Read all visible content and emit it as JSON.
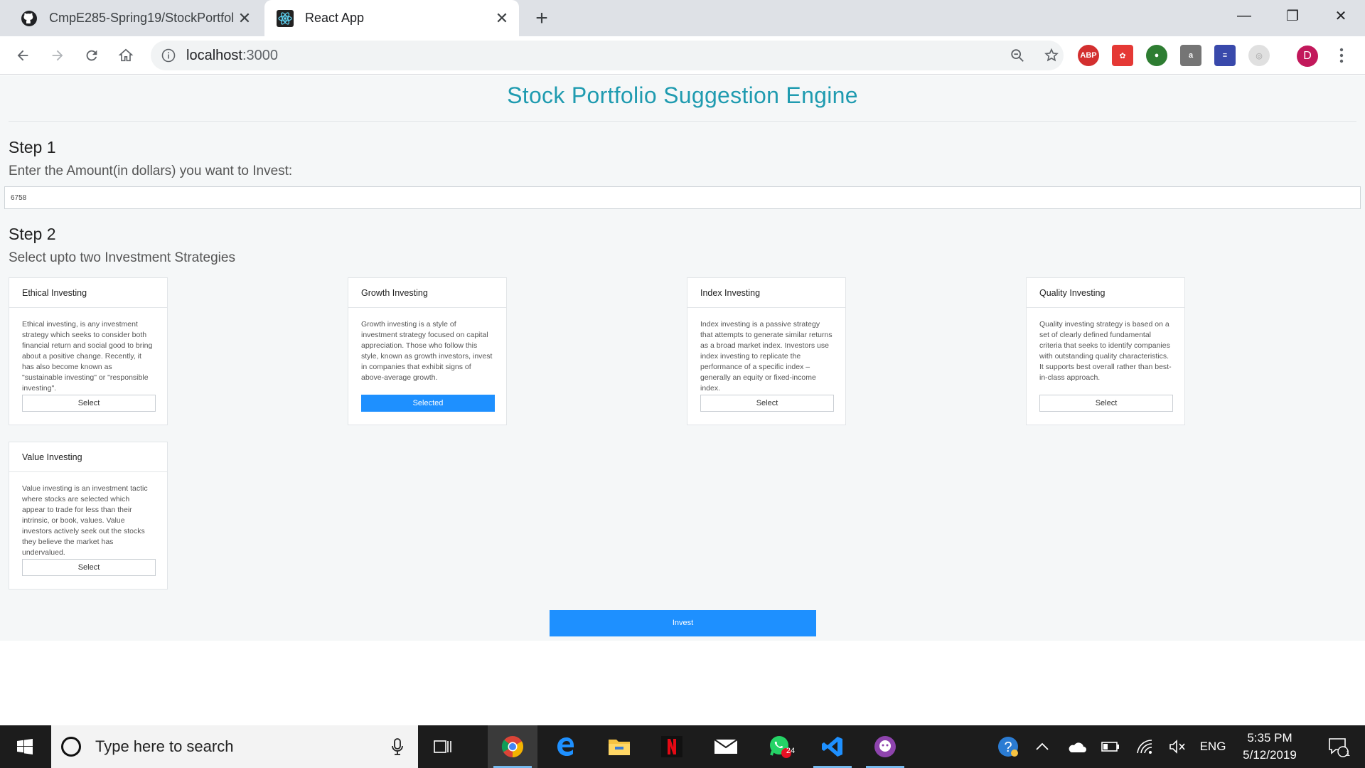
{
  "browser": {
    "tabs": [
      {
        "title": "CmpE285-Spring19/StockPortfoli",
        "icon": "github-icon",
        "active": false
      },
      {
        "title": "React App",
        "icon": "react-icon",
        "active": true
      }
    ],
    "url_host": "localhost",
    "url_port": ":3000",
    "profile_initial": "D",
    "extensions": [
      "adblock-icon",
      "ext-red-icon",
      "ext-green-icon",
      "ext-bag-icon",
      "ext-stack-icon",
      "ext-circle-icon"
    ]
  },
  "app": {
    "title": "Stock Portfolio Suggestion Engine",
    "step1": {
      "heading": "Step 1",
      "label": "Enter the Amount(in dollars) you want to Invest:",
      "amount_value": "6758"
    },
    "step2": {
      "heading": "Step 2",
      "label": "Select upto two Investment Strategies"
    },
    "strategies": [
      {
        "name": "Ethical Investing",
        "description": "Ethical investing, is any investment strategy which seeks to consider both financial return and social good to bring about a positive change. Recently, it has also become known as \"sustainable investing\" or \"responsible investing\".",
        "button": "Select",
        "selected": false
      },
      {
        "name": "Growth Investing",
        "description": "Growth investing is a style of investment strategy focused on capital appreciation. Those who follow this style, known as growth investors, invest in companies that exhibit signs of above-average growth.",
        "button": "Selected",
        "selected": true
      },
      {
        "name": "Index Investing",
        "description": "Index investing is a passive strategy that attempts to generate similar returns as a broad market index. Investors use index investing to replicate the performance of a specific index – generally an equity or fixed-income index.",
        "button": "Select",
        "selected": false
      },
      {
        "name": "Quality Investing",
        "description": "Quality investing strategy is based on a set of clearly defined fundamental criteria that seeks to identify companies with outstanding quality characteristics. It supports best overall rather than best-in-class approach.",
        "button": "Select",
        "selected": false
      },
      {
        "name": "Value Investing",
        "description": "Value investing is an investment tactic where stocks are selected which appear to trade for less than their intrinsic, or book, values. Value investors actively seek out the stocks they believe the market has undervalued.",
        "button": "Select",
        "selected": false
      }
    ],
    "invest_button": "Invest"
  },
  "taskbar": {
    "search_placeholder": "Type here to search",
    "whatsapp_badge": "24",
    "language": "ENG",
    "time": "5:35 PM",
    "date": "5/12/2019",
    "notification_count": "1"
  },
  "colors": {
    "title": "#1f9bb0",
    "primary_button": "#1e90ff",
    "page_bg": "#f5f7f8"
  }
}
